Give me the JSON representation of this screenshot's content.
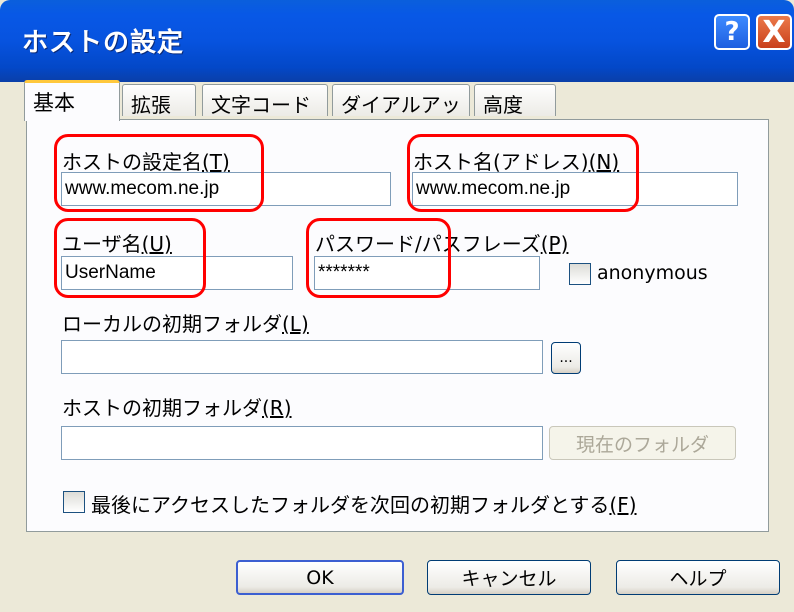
{
  "window": {
    "title": "ホストの設定",
    "help_glyph": "?",
    "close_glyph": "X"
  },
  "tabs": [
    {
      "label": "基本",
      "active": true
    },
    {
      "label": "拡張"
    },
    {
      "label": "文字コード"
    },
    {
      "label": "ダイアルアップ"
    },
    {
      "label": "高度"
    }
  ],
  "form": {
    "host_setting_name": {
      "label": "ホストの設定名",
      "mnemonic": "(T)",
      "value": "www.mecom.ne.jp"
    },
    "host_name": {
      "label": "ホスト名(アドレス)",
      "mnemonic": "(N)",
      "value": "www.mecom.ne.jp"
    },
    "user_name": {
      "label": "ユーザ名",
      "mnemonic": "(U)",
      "value": "UserName"
    },
    "password": {
      "label": "パスワード/パスフレーズ",
      "mnemonic": "(P)",
      "value": "*******"
    },
    "anonymous": {
      "label": "anonymous",
      "checked": false
    },
    "local_folder": {
      "label": "ローカルの初期フォルダ",
      "mnemonic": "(L)",
      "value": "",
      "browse_label": "..."
    },
    "host_folder": {
      "label": "ホストの初期フォルダ",
      "mnemonic": "(R)",
      "value": "",
      "current_folder_label": "現在のフォルダ"
    },
    "last_folder": {
      "label": "最後にアクセスしたフォルダを次回の初期フォルダとする",
      "mnemonic": "(F)",
      "checked": false
    }
  },
  "buttons": {
    "ok": "OK",
    "cancel": "キャンセル",
    "help": "ヘルプ"
  },
  "colors": {
    "titlebar": "#0753df",
    "highlight": "#ff0000",
    "dialog_bg": "#ece9d8"
  }
}
